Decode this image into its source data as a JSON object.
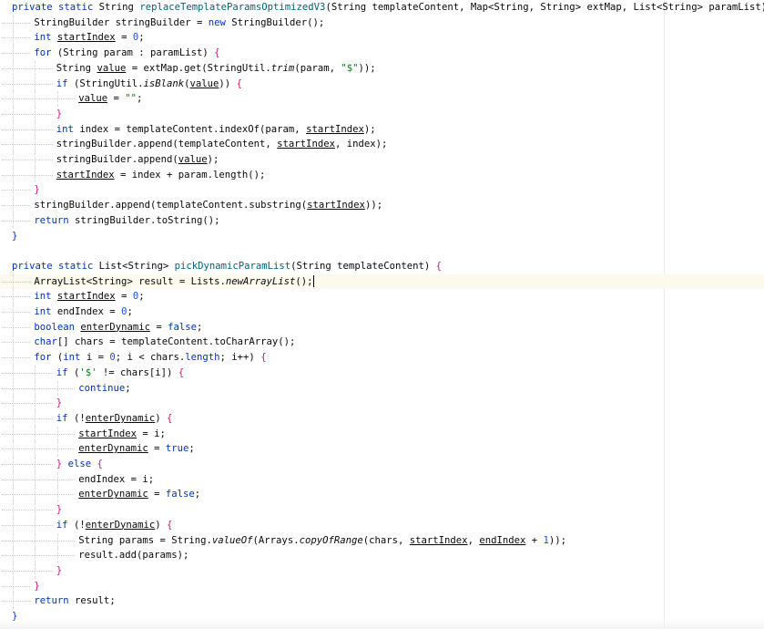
{
  "editor": {
    "caret_line": 18,
    "lines": [
      {
        "indent": 0,
        "t": [
          [
            "private static ",
            "kw"
          ],
          [
            "String ",
            ""
          ],
          [
            "replaceTemplateParamsOptimizedV3",
            "fn"
          ],
          [
            "(String templateContent, Map<String, String> extMap, List<String> paramList) ",
            ""
          ],
          [
            "{",
            "brace"
          ]
        ]
      },
      {
        "indent": 1,
        "t": [
          [
            "StringBuilder stringBuilder = ",
            ""
          ],
          [
            "new ",
            "kw"
          ],
          [
            "StringBuilder();",
            ""
          ]
        ]
      },
      {
        "indent": 1,
        "t": [
          [
            "int ",
            "kw"
          ],
          [
            "startIndex",
            "var"
          ],
          [
            " = ",
            ""
          ],
          [
            "0",
            "num"
          ],
          [
            ";",
            ""
          ]
        ]
      },
      {
        "indent": 1,
        "t": [
          [
            "for ",
            "kw"
          ],
          [
            "(String param : paramList) ",
            ""
          ],
          [
            "{",
            "brace"
          ]
        ]
      },
      {
        "indent": 2,
        "t": [
          [
            "String ",
            ""
          ],
          [
            "value",
            "var"
          ],
          [
            " = extMap.get(StringUtil.",
            ""
          ],
          [
            "trim",
            "it"
          ],
          [
            "(param, ",
            ""
          ],
          [
            "\"$\"",
            "str"
          ],
          [
            "));",
            ""
          ]
        ]
      },
      {
        "indent": 2,
        "t": [
          [
            "if ",
            "kw"
          ],
          [
            "(StringUtil.",
            ""
          ],
          [
            "isBlank",
            "it"
          ],
          [
            "(",
            ""
          ],
          [
            "value",
            "var"
          ],
          [
            ")) ",
            ""
          ],
          [
            "{",
            "brace"
          ]
        ]
      },
      {
        "indent": 3,
        "t": [
          [
            "value",
            "var"
          ],
          [
            " = ",
            ""
          ],
          [
            "\"\"",
            "str"
          ],
          [
            ";",
            ""
          ]
        ]
      },
      {
        "indent": 2,
        "t": [
          [
            "}",
            "brace"
          ]
        ]
      },
      {
        "indent": 2,
        "t": [
          [
            "int ",
            "kw"
          ],
          [
            "index = templateContent.indexOf(param, ",
            ""
          ],
          [
            "startIndex",
            "var"
          ],
          [
            ");",
            ""
          ]
        ]
      },
      {
        "indent": 2,
        "t": [
          [
            "stringBuilder.append(templateContent, ",
            ""
          ],
          [
            "startIndex",
            "var"
          ],
          [
            ", index);",
            ""
          ]
        ]
      },
      {
        "indent": 2,
        "t": [
          [
            "stringBuilder.append(",
            ""
          ],
          [
            "value",
            "var"
          ],
          [
            ");",
            ""
          ]
        ]
      },
      {
        "indent": 2,
        "t": [
          [
            "startIndex",
            "var"
          ],
          [
            " = index + param.length();",
            ""
          ]
        ]
      },
      {
        "indent": 1,
        "t": [
          [
            "}",
            "brace"
          ]
        ]
      },
      {
        "indent": 1,
        "t": [
          [
            "stringBuilder.append(templateContent.substring(",
            ""
          ],
          [
            "startIndex",
            "var"
          ],
          [
            "));",
            ""
          ]
        ]
      },
      {
        "indent": 1,
        "t": [
          [
            "return ",
            "kw"
          ],
          [
            "stringBuilder.toString();",
            ""
          ]
        ]
      },
      {
        "indent": 0,
        "t": [
          [
            "}",
            "kw"
          ]
        ]
      },
      {
        "indent": 0,
        "t": []
      },
      {
        "indent": 0,
        "t": [
          [
            "private static ",
            "kw"
          ],
          [
            "List<String> ",
            ""
          ],
          [
            "pickDynamicParamList",
            "fn"
          ],
          [
            "(String templateContent) ",
            ""
          ],
          [
            "{",
            "brace"
          ]
        ]
      },
      {
        "indent": 1,
        "t": [
          [
            "ArrayList<String> result = Lists.",
            ""
          ],
          [
            "newArrayList",
            "it"
          ],
          [
            "();",
            ""
          ]
        ]
      },
      {
        "indent": 1,
        "t": [
          [
            "int ",
            "kw"
          ],
          [
            "startIndex",
            "var"
          ],
          [
            " = ",
            ""
          ],
          [
            "0",
            "num"
          ],
          [
            ";",
            ""
          ]
        ]
      },
      {
        "indent": 1,
        "t": [
          [
            "int ",
            "kw"
          ],
          [
            "endIndex = ",
            ""
          ],
          [
            "0",
            "num"
          ],
          [
            ";",
            ""
          ]
        ]
      },
      {
        "indent": 1,
        "t": [
          [
            "boolean ",
            "kw"
          ],
          [
            "enterDynamic",
            "var"
          ],
          [
            " = ",
            ""
          ],
          [
            "false",
            "kw"
          ],
          [
            ";",
            ""
          ]
        ]
      },
      {
        "indent": 1,
        "t": [
          [
            "char",
            "kw"
          ],
          [
            "[] chars = templateContent.toCharArray();",
            ""
          ]
        ]
      },
      {
        "indent": 1,
        "t": [
          [
            "for ",
            "kw"
          ],
          [
            "(",
            ""
          ],
          [
            "int ",
            "kw"
          ],
          [
            "i = ",
            ""
          ],
          [
            "0",
            "num"
          ],
          [
            "; i < chars.",
            ""
          ],
          [
            "length",
            "kw"
          ],
          [
            "; i++) ",
            ""
          ],
          [
            "{",
            "brace"
          ]
        ]
      },
      {
        "indent": 2,
        "t": [
          [
            "if ",
            "kw"
          ],
          [
            "(",
            ""
          ],
          [
            "'$'",
            "str"
          ],
          [
            " != chars[i]) ",
            ""
          ],
          [
            "{",
            "brace"
          ]
        ]
      },
      {
        "indent": 3,
        "t": [
          [
            "continue",
            "kw"
          ],
          [
            ";",
            ""
          ]
        ]
      },
      {
        "indent": 2,
        "t": [
          [
            "}",
            "brace"
          ]
        ]
      },
      {
        "indent": 2,
        "t": [
          [
            "if ",
            "kw"
          ],
          [
            "(!",
            ""
          ],
          [
            "enterDynamic",
            "var"
          ],
          [
            ") ",
            ""
          ],
          [
            "{",
            "brace"
          ]
        ]
      },
      {
        "indent": 3,
        "t": [
          [
            "startIndex",
            "var"
          ],
          [
            " = i;",
            ""
          ]
        ]
      },
      {
        "indent": 3,
        "t": [
          [
            "enterDynamic",
            "var"
          ],
          [
            " = ",
            ""
          ],
          [
            "true",
            "kw"
          ],
          [
            ";",
            ""
          ]
        ]
      },
      {
        "indent": 2,
        "t": [
          [
            "} ",
            "brace"
          ],
          [
            "else ",
            "kw"
          ],
          [
            "{",
            "brace"
          ]
        ]
      },
      {
        "indent": 3,
        "t": [
          [
            "endIndex = i;",
            ""
          ]
        ]
      },
      {
        "indent": 3,
        "t": [
          [
            "enterDynamic",
            "var"
          ],
          [
            " = ",
            ""
          ],
          [
            "false",
            "kw"
          ],
          [
            ";",
            ""
          ]
        ]
      },
      {
        "indent": 2,
        "t": [
          [
            "}",
            "brace"
          ]
        ]
      },
      {
        "indent": 2,
        "t": [
          [
            "if ",
            "kw"
          ],
          [
            "(!",
            ""
          ],
          [
            "enterDynamic",
            "var"
          ],
          [
            ") ",
            ""
          ],
          [
            "{",
            "brace"
          ]
        ]
      },
      {
        "indent": 3,
        "t": [
          [
            "String params = String.",
            ""
          ],
          [
            "valueOf",
            "it"
          ],
          [
            "(Arrays.",
            ""
          ],
          [
            "copyOfRange",
            "it"
          ],
          [
            "(chars, ",
            ""
          ],
          [
            "startIndex",
            "var"
          ],
          [
            ", ",
            ""
          ],
          [
            "endIndex",
            "var"
          ],
          [
            " + ",
            ""
          ],
          [
            "1",
            "num"
          ],
          [
            "));",
            ""
          ]
        ]
      },
      {
        "indent": 3,
        "t": [
          [
            "result.add(params);",
            ""
          ]
        ]
      },
      {
        "indent": 2,
        "t": [
          [
            "}",
            "brace"
          ]
        ]
      },
      {
        "indent": 1,
        "t": [
          [
            "}",
            "brace"
          ]
        ]
      },
      {
        "indent": 1,
        "t": [
          [
            "return ",
            "kw"
          ],
          [
            "result;",
            ""
          ]
        ]
      },
      {
        "indent": 0,
        "t": [
          [
            "}",
            "kw"
          ]
        ]
      }
    ]
  }
}
